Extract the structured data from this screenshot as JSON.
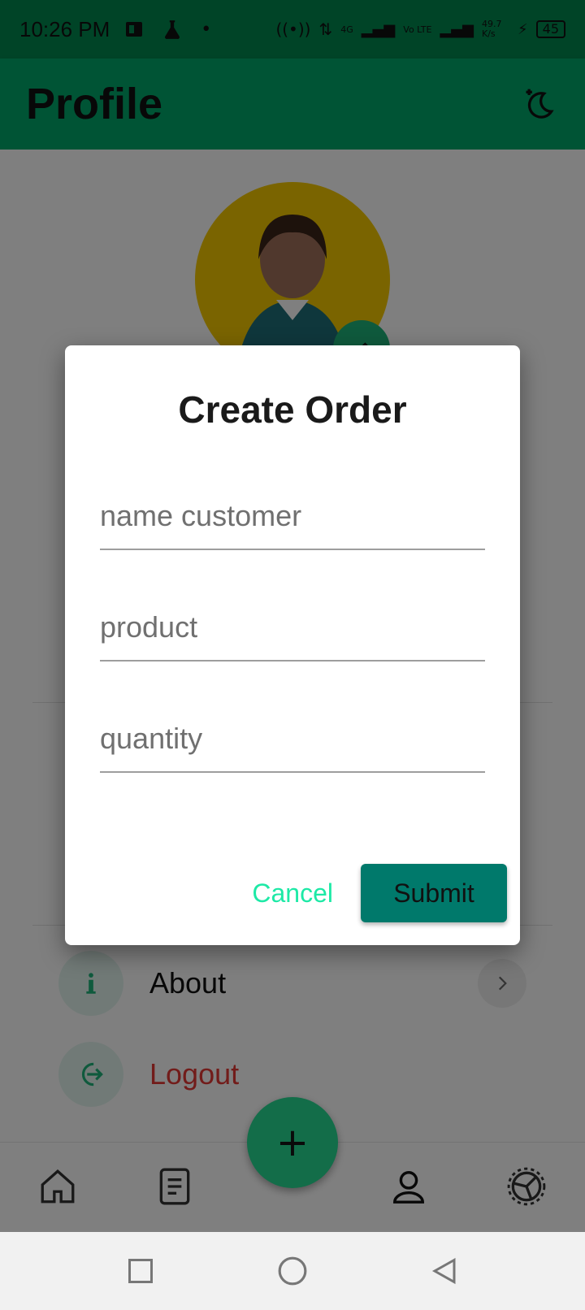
{
  "status_bar": {
    "time": "10:26 PM",
    "net_speed": "49.7 K/s",
    "battery": "45",
    "network_4g": "4G",
    "network_volte": "Vo LTE"
  },
  "app_bar": {
    "title": "Profile",
    "theme_icon": "moon-sparkle-icon"
  },
  "profile": {
    "avatar_icon": "user-avatar",
    "edit_icon": "pencil-icon"
  },
  "menu": {
    "items": [
      {
        "label": "About",
        "icon": "info-icon"
      },
      {
        "label": "Logout",
        "icon": "logout-icon"
      }
    ]
  },
  "bottom_nav": {
    "items": [
      "home-icon",
      "document-icon",
      "person-icon",
      "settings-icon"
    ],
    "fab_label": "+"
  },
  "dialog": {
    "title": "Create Order",
    "fields": [
      {
        "placeholder": "name customer"
      },
      {
        "placeholder": "product"
      },
      {
        "placeholder": "quantity"
      }
    ],
    "cancel_label": "Cancel",
    "submit_label": "Submit"
  },
  "colors": {
    "status_bar": "#00884f",
    "app_bar": "#00a86b",
    "fab": "#1fb57a",
    "submit": "#00796b",
    "cancel_text": "#1de9a6",
    "logout_text": "#e53935",
    "avatar_bg": "#f5c900"
  }
}
